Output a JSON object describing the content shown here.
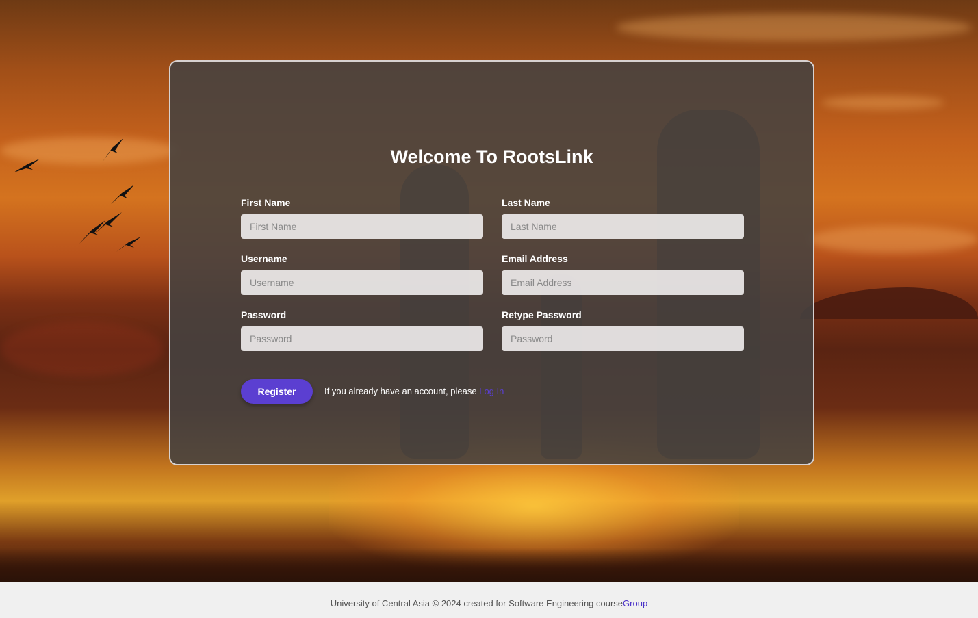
{
  "form": {
    "title": "Welcome To RootsLink",
    "first_name": {
      "label": "First Name",
      "placeholder": "First Name"
    },
    "last_name": {
      "label": "Last Name",
      "placeholder": "Last Name"
    },
    "username": {
      "label": "Username",
      "placeholder": "Username"
    },
    "email": {
      "label": "Email Address",
      "placeholder": "Email Address"
    },
    "password": {
      "label": "Password",
      "placeholder": "Password"
    },
    "retype_password": {
      "label": "Retype Password",
      "placeholder": "Password"
    },
    "register_label": "Register",
    "login_prompt": "If you already have an account, please ",
    "login_link": "Log In"
  },
  "footer": {
    "text": "University of Central Asia © 2024 created for Software Engineering course",
    "link": "Group"
  },
  "colors": {
    "accent": "#5b3fd1",
    "card_bg": "#46423f",
    "footer_bg": "#f0f0f0"
  }
}
